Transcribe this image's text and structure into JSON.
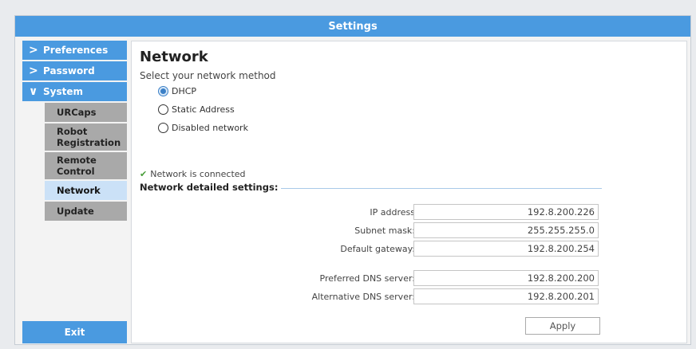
{
  "window": {
    "title": "Settings"
  },
  "sidebar": {
    "top_items": [
      {
        "label": "Preferences",
        "chevron": ">"
      },
      {
        "label": "Password",
        "chevron": ">"
      },
      {
        "label": "System",
        "chevron": "∨"
      }
    ],
    "sub_items": [
      {
        "label": "URCaps"
      },
      {
        "label": "Robot Registration"
      },
      {
        "label": "Remote Control"
      },
      {
        "label": "Network",
        "active": true
      },
      {
        "label": "Update"
      }
    ],
    "exit_label": "Exit"
  },
  "content": {
    "title": "Network",
    "subtitle": "Select your network method",
    "methods": [
      {
        "label": "DHCP",
        "selected": true
      },
      {
        "label": "Static Address",
        "selected": false
      },
      {
        "label": "Disabled network",
        "selected": false
      }
    ],
    "status": "Network is connected",
    "section_title": "Network detailed settings:",
    "fields": [
      {
        "label": "IP address",
        "value": "192.8.200.226"
      },
      {
        "label": "Subnet mask:",
        "value": "255.255.255.0"
      },
      {
        "label": "Default gateway:",
        "value": "192.8.200.254"
      },
      {
        "label": "Preferred DNS server:",
        "value": "192.8.200.200"
      },
      {
        "label": "Alternative DNS server:",
        "value": "192.8.200.201"
      }
    ],
    "apply_label": "Apply"
  },
  "colors": {
    "accent": "#4a9ae0",
    "submenu": "#a9a9a9",
    "submenu_active": "#cbe1f7",
    "status_check": "#4a9e3a"
  }
}
